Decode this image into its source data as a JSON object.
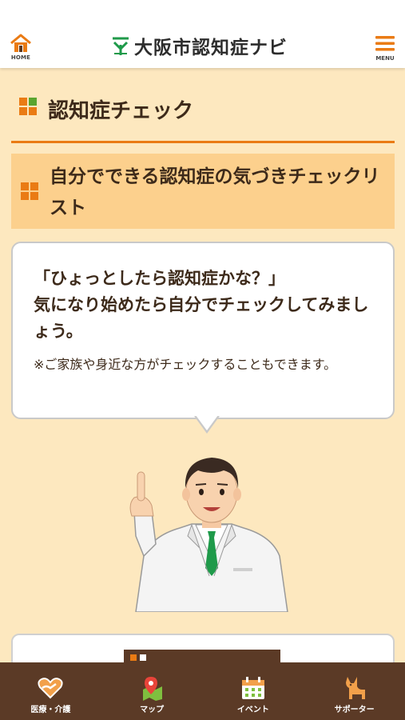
{
  "header": {
    "home_label": "HOME",
    "logo_text": "大阪市認知症ナビ",
    "menu_label": "MENU"
  },
  "section": {
    "title": "認知症チェック"
  },
  "subsection": {
    "title": "自分でできる認知症の気づきチェックリスト"
  },
  "bubble": {
    "line1": "「ひょっとしたら認知症かな？」",
    "line2": "気になり始めたら自分でチェックしてみましょう。",
    "note": "※ご家族や身近な方がチェックすることもできます。"
  },
  "pager": {
    "current_page": 1,
    "total_pages": 2
  },
  "tabbar": {
    "items": [
      {
        "label": "医療・介護",
        "icon": "heart-hands-icon"
      },
      {
        "label": "マップ",
        "icon": "map-pin-icon"
      },
      {
        "label": "イベント",
        "icon": "calendar-icon"
      },
      {
        "label": "サポーター",
        "icon": "dog-icon"
      }
    ]
  },
  "colors": {
    "accent": "#ea7b14",
    "background": "#fde8bf",
    "subsection_bg": "#fcd08d",
    "tabbar_bg": "#5b3a26",
    "logo_green": "#1f9a4a"
  }
}
